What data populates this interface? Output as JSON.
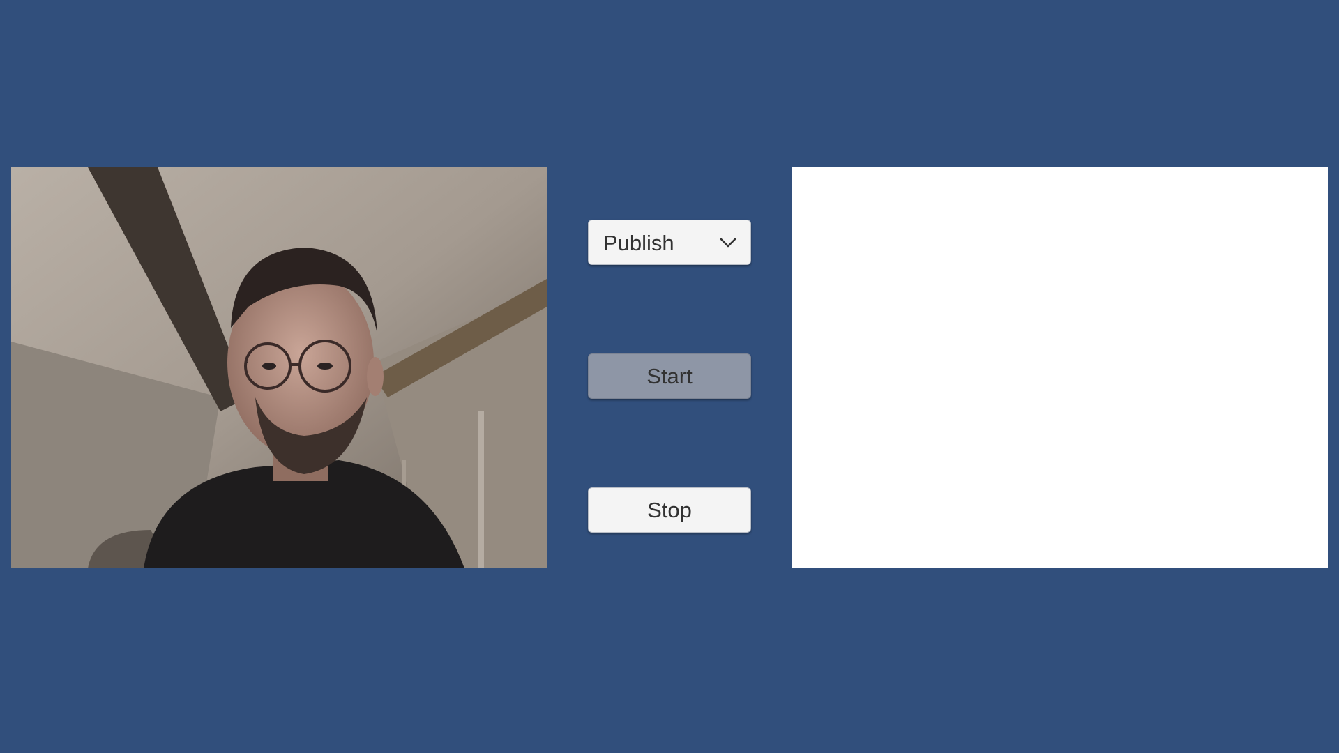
{
  "controls": {
    "mode_dropdown": {
      "selected": "Publish",
      "icon": "chevron-down-icon"
    },
    "start_label": "Start",
    "stop_label": "Stop"
  },
  "colors": {
    "background": "#314F7C",
    "button_default": "#F4F4F4",
    "button_active": "#8E96A6",
    "remote_panel": "#FFFFFF",
    "text": "#323232"
  }
}
